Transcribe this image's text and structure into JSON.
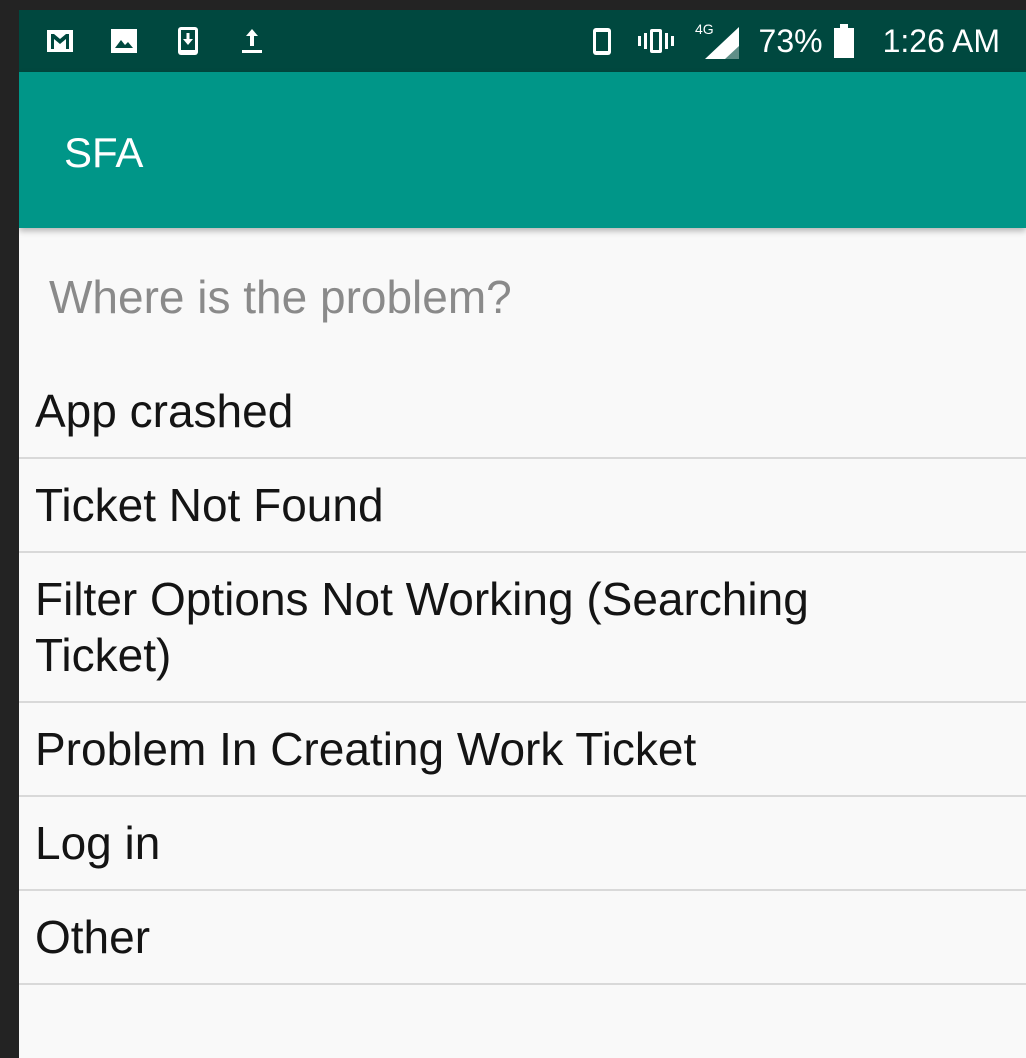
{
  "status_bar": {
    "left_icons": [
      "gmail-icon",
      "image-icon",
      "download-icon",
      "upload-icon"
    ],
    "right_icons": [
      "phone-icon",
      "vibrate-icon",
      "signal-4g-icon"
    ],
    "network_label": "4G",
    "battery_percent": "73%",
    "battery_icon": "battery-icon",
    "time": "1:26 AM",
    "background_color": "#00483f"
  },
  "app_bar": {
    "title": "SFA",
    "background_color": "#009688"
  },
  "main": {
    "question": "Where is the problem?",
    "options": [
      {
        "label": "App crashed"
      },
      {
        "label": "Ticket Not Found"
      },
      {
        "label": "Filter Options Not Working (Searching Ticket)"
      },
      {
        "label": "Problem In Creating Work Ticket"
      },
      {
        "label": "Log in"
      },
      {
        "label": "Other"
      }
    ]
  }
}
